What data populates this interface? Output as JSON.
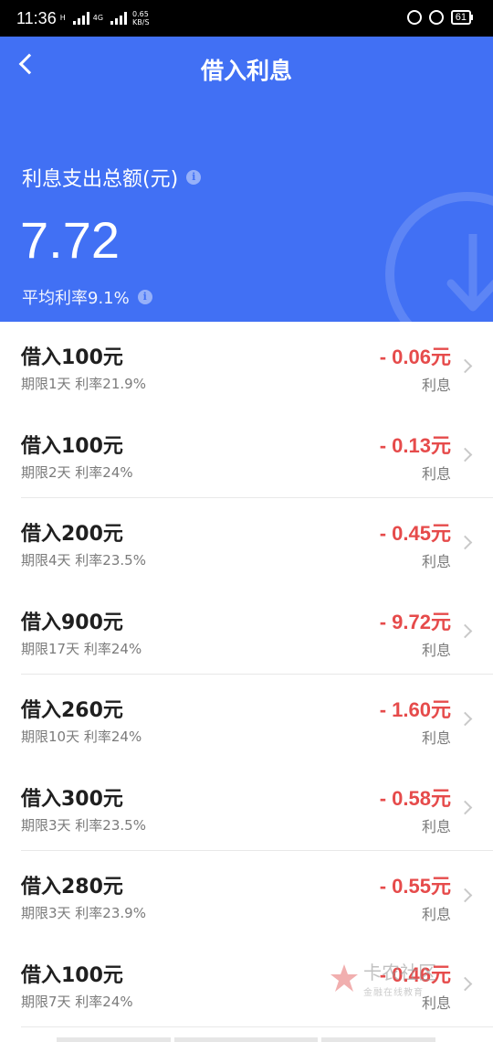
{
  "status_bar": {
    "time": "11:36",
    "network_h": "H",
    "network_4g": "4G",
    "speed_value": "0.65",
    "speed_unit": "KB/S",
    "battery": "61"
  },
  "header": {
    "title": "借入利息",
    "summary_label": "利息支出总额(元)",
    "total": "7.72",
    "avg_rate_label": "平均利率9.1%",
    "info_glyph": "i",
    "background_color": "#4170f4"
  },
  "colors": {
    "amount": "#e64b4b",
    "secondary_text": "#7b7b7b"
  },
  "loans": [
    {
      "name": "借入100元",
      "meta": "期限1天 利率21.9%",
      "amount": "- 0.06元",
      "label": "利息"
    },
    {
      "name": "借入100元",
      "meta": "期限2天 利率24%",
      "amount": "- 0.13元",
      "label": "利息"
    },
    {
      "name": "借入200元",
      "meta": "期限4天 利率23.5%",
      "amount": "- 0.45元",
      "label": "利息"
    },
    {
      "name": "借入900元",
      "meta": "期限17天 利率24%",
      "amount": "- 9.72元",
      "label": "利息"
    },
    {
      "name": "借入260元",
      "meta": "期限10天 利率24%",
      "amount": "- 1.60元",
      "label": "利息"
    },
    {
      "name": "借入300元",
      "meta": "期限3天 利率23.5%",
      "amount": "- 0.58元",
      "label": "利息"
    },
    {
      "name": "借入280元",
      "meta": "期限3天 利率23.9%",
      "amount": "- 0.55元",
      "label": "利息"
    },
    {
      "name": "借入100元",
      "meta": "期限7天 利率24%",
      "amount": "- 0.46元",
      "label": "利息"
    }
  ],
  "watermark": {
    "main": "卡农社区",
    "sub": "金融在线教育"
  }
}
